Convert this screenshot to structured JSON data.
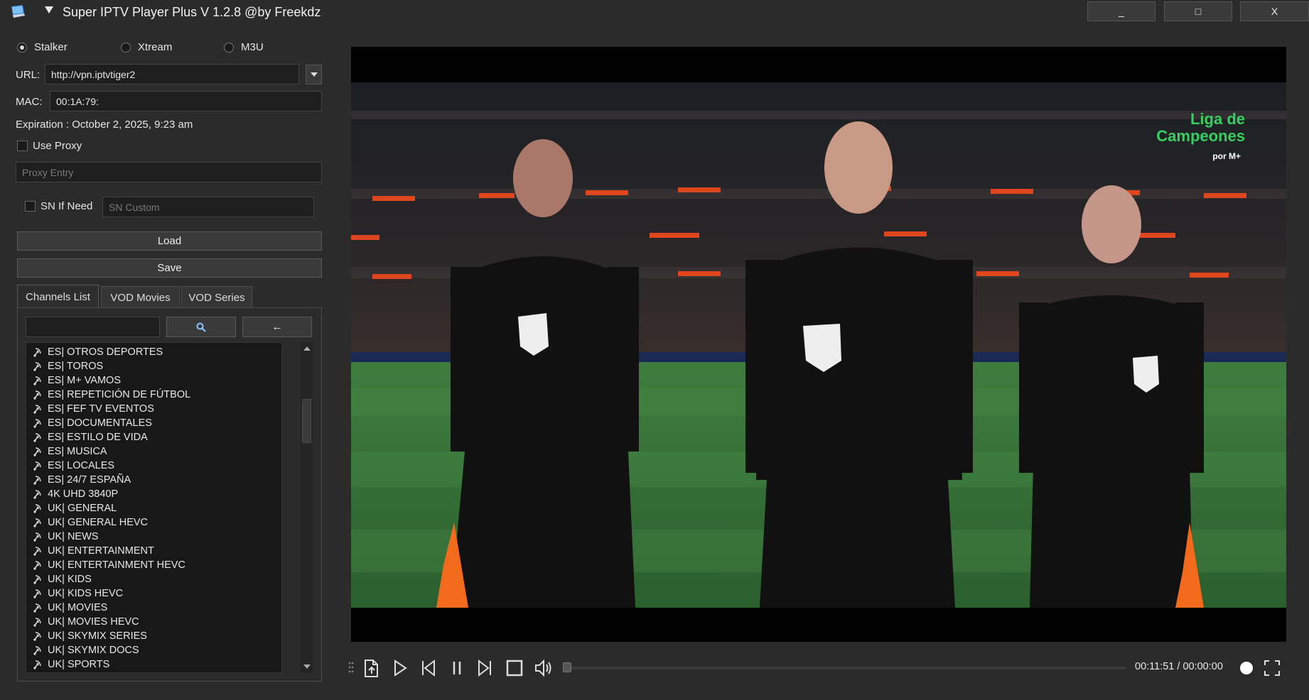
{
  "window": {
    "title": "Super IPTV Player Plus V 1.2.8 @by Freekdz",
    "minimize_label": "_",
    "maximize_label": "□",
    "close_label": "X"
  },
  "source_types": [
    {
      "label": "Stalker",
      "selected": true
    },
    {
      "label": "Xtream",
      "selected": false
    },
    {
      "label": "M3U",
      "selected": false
    }
  ],
  "form": {
    "url_label": "URL:",
    "url_value": "http://vpn.iptvtiger2",
    "mac_label": "MAC:",
    "mac_value": "00:1A:79:",
    "expiration": "Expiration : October 2, 2025, 9:23 am",
    "use_proxy_label": "Use Proxy",
    "proxy_placeholder": "Proxy Entry",
    "sn_label": "SN If Need",
    "sn_placeholder": "SN Custom",
    "load_label": "Load",
    "save_label": "Save"
  },
  "tabs": [
    {
      "label": "Channels List",
      "active": true
    },
    {
      "label": "VOD Movies",
      "active": false
    },
    {
      "label": "VOD Series",
      "active": false
    }
  ],
  "search": {
    "value": "",
    "search_icon": "magnifier-icon",
    "back_label": "←"
  },
  "channels": [
    "ES| OTROS DEPORTES",
    "ES| TOROS",
    "ES| M+ VAMOS",
    "ES| REPETICIÓN DE FÚTBOL",
    "ES| FEF TV EVENTOS",
    "ES| DOCUMENTALES",
    "ES| ESTILO DE VIDA",
    "ES| MUSICA",
    "ES| LOCALES",
    "ES| 24/7 ESPAÑA",
    "4K UHD 3840P",
    "UK| GENERAL",
    "UK| GENERAL HEVC",
    "UK| NEWS",
    "UK| ENTERTAINMENT",
    "UK| ENTERTAINMENT HEVC",
    "UK| KIDS",
    "UK| KIDS HEVC",
    "UK| MOVIES",
    "UK| MOVIES HEVC",
    "UK| SKYMIX SERIES",
    "UK| SKYMIX DOCS",
    "UK| SPORTS"
  ],
  "video": {
    "watermark_line1": "Liga de",
    "watermark_line2": "Campeones",
    "watermark_sub": "por M+"
  },
  "player": {
    "time": "00:11:51 / 00:00:00",
    "progress": 0.0
  },
  "colors": {
    "background": "#2b2b2b",
    "field": "#1e1e1e",
    "button": "#3a3a3a",
    "accent_green": "#35d061",
    "pitch": "#2f6b35"
  }
}
